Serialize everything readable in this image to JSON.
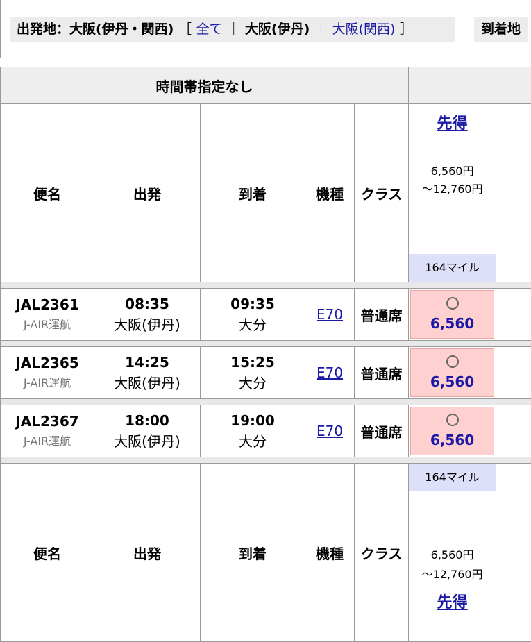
{
  "origin": {
    "label": "出発地：大阪(伊丹・関西)",
    "bracket_open": "［",
    "filter_all": "全て",
    "sep1": "｜",
    "filter_itami": "大阪(伊丹)",
    "sep2": "｜",
    "filter_kansai": "大阪(関西)",
    "bracket_close": "］"
  },
  "destination": {
    "label": "到着地"
  },
  "table": {
    "time_band_header": "時間帯指定なし",
    "columns": {
      "flight": "便名",
      "departure": "出発",
      "arrival": "到着",
      "aircraft": "機種",
      "class": "クラス"
    },
    "fare_column": {
      "link": "先得",
      "price_min": "6,560円",
      "price_max": "～12,760円",
      "miles": "164マイル"
    },
    "flights": [
      {
        "number": "JAL2361",
        "operator": "J-AIR運航",
        "dep_time": "08:35",
        "dep_airport": "大阪(伊丹)",
        "arr_time": "09:35",
        "arr_airport": "大分",
        "aircraft": "E70",
        "class": "普通席",
        "availability": "○",
        "fare": "6,560"
      },
      {
        "number": "JAL2365",
        "operator": "J-AIR運航",
        "dep_time": "14:25",
        "dep_airport": "大阪(伊丹)",
        "arr_time": "15:25",
        "arr_airport": "大分",
        "aircraft": "E70",
        "class": "普通席",
        "availability": "○",
        "fare": "6,560"
      },
      {
        "number": "JAL2367",
        "operator": "J-AIR運航",
        "dep_time": "18:00",
        "dep_airport": "大阪(伊丹)",
        "arr_time": "19:00",
        "arr_airport": "大分",
        "aircraft": "E70",
        "class": "普通席",
        "availability": "○",
        "fare": "6,560"
      }
    ]
  },
  "colors": {
    "link": "#1a1aa6",
    "fare_bg": "#ffd0d0",
    "miles_bg": "#dde0f8",
    "header_bg": "#eeeeee"
  }
}
